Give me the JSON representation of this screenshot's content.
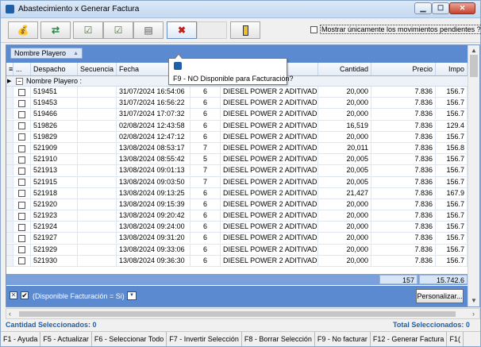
{
  "window": {
    "title": "Abastecimiento x Generar Factura",
    "min_glyph": "▁",
    "max_glyph": "☐",
    "close_glyph": "✕"
  },
  "toolbar": {
    "buttons": [
      {
        "icon": "money-bag-icon",
        "glyph": "💰"
      },
      {
        "icon": "refresh-icon",
        "glyph": "⇄"
      },
      {
        "icon": "check-list-icon",
        "glyph": "☑"
      },
      {
        "icon": "uncheck-list-icon",
        "glyph": "☑"
      },
      {
        "icon": "save-icon",
        "glyph": "▤"
      },
      {
        "icon": "not-available-icon",
        "glyph": "✖"
      },
      {
        "icon": "disabled-icon",
        "glyph": ""
      },
      {
        "icon": "exit-door-icon",
        "glyph": ""
      }
    ],
    "pending_label": "Mostrar únicamente los movimientos pendientes ?"
  },
  "grid": {
    "group_chip": "Nombre Playero",
    "columns": [
      "...",
      "Despacho",
      "Secuencia",
      "Fecha",
      "",
      "",
      "Cantidad",
      "Precio",
      "Impo"
    ],
    "group_row_label": "Nombre Playero :",
    "rows": [
      {
        "despacho": "519451",
        "fecha": "31/07/2024 16:54:06",
        "cod": "6",
        "producto": "DIESEL POWER 2 ADITIVAD",
        "cantidad": "20,000",
        "precio": "7.836",
        "importe": "156.7"
      },
      {
        "despacho": "519453",
        "fecha": "31/07/2024 16:56:22",
        "cod": "6",
        "producto": "DIESEL POWER 2 ADITIVAD",
        "cantidad": "20,000",
        "precio": "7.836",
        "importe": "156.7"
      },
      {
        "despacho": "519466",
        "fecha": "31/07/2024 17:07:32",
        "cod": "6",
        "producto": "DIESEL POWER 2 ADITIVAD",
        "cantidad": "20,000",
        "precio": "7.836",
        "importe": "156.7"
      },
      {
        "despacho": "519826",
        "fecha": "02/08/2024 12:43:58",
        "cod": "6",
        "producto": "DIESEL POWER 2 ADITIVAD",
        "cantidad": "16,519",
        "precio": "7.836",
        "importe": "129.4"
      },
      {
        "despacho": "519829",
        "fecha": "02/08/2024 12:47:12",
        "cod": "6",
        "producto": "DIESEL POWER 2 ADITIVAD",
        "cantidad": "20,000",
        "precio": "7.836",
        "importe": "156.7"
      },
      {
        "despacho": "521909",
        "fecha": "13/08/2024 08:53:17",
        "cod": "7",
        "producto": "DIESEL POWER 2 ADITIVAD",
        "cantidad": "20,011",
        "precio": "7.836",
        "importe": "156.8"
      },
      {
        "despacho": "521910",
        "fecha": "13/08/2024 08:55:42",
        "cod": "5",
        "producto": "DIESEL POWER 2 ADITIVAD",
        "cantidad": "20,005",
        "precio": "7.836",
        "importe": "156.7"
      },
      {
        "despacho": "521913",
        "fecha": "13/08/2024 09:01:13",
        "cod": "7",
        "producto": "DIESEL POWER 2 ADITIVAD",
        "cantidad": "20,005",
        "precio": "7.836",
        "importe": "156.7"
      },
      {
        "despacho": "521915",
        "fecha": "13/08/2024 09:03:50",
        "cod": "7",
        "producto": "DIESEL POWER 2 ADITIVAD",
        "cantidad": "20,005",
        "precio": "7.836",
        "importe": "156.7"
      },
      {
        "despacho": "521918",
        "fecha": "13/08/2024 09:13:25",
        "cod": "6",
        "producto": "DIESEL POWER 2 ADITIVAD",
        "cantidad": "21,427",
        "precio": "7.836",
        "importe": "167.9"
      },
      {
        "despacho": "521920",
        "fecha": "13/08/2024 09:15:39",
        "cod": "6",
        "producto": "DIESEL POWER 2 ADITIVAD",
        "cantidad": "20,000",
        "precio": "7.836",
        "importe": "156.7"
      },
      {
        "despacho": "521923",
        "fecha": "13/08/2024 09:20:42",
        "cod": "6",
        "producto": "DIESEL POWER 2 ADITIVAD",
        "cantidad": "20,000",
        "precio": "7.836",
        "importe": "156.7"
      },
      {
        "despacho": "521924",
        "fecha": "13/08/2024 09:24:00",
        "cod": "6",
        "producto": "DIESEL POWER 2 ADITIVAD",
        "cantidad": "20,000",
        "precio": "7.836",
        "importe": "156.7"
      },
      {
        "despacho": "521927",
        "fecha": "13/08/2024 09:31:20",
        "cod": "6",
        "producto": "DIESEL POWER 2 ADITIVAD",
        "cantidad": "20,000",
        "precio": "7.836",
        "importe": "156.7"
      },
      {
        "despacho": "521929",
        "fecha": "13/08/2024 09:33:06",
        "cod": "6",
        "producto": "DIESEL POWER 2 ADITIVAD",
        "cantidad": "20,000",
        "precio": "7.836",
        "importe": "156.7"
      },
      {
        "despacho": "521930",
        "fecha": "13/08/2024 09:36:30",
        "cod": "6",
        "producto": "DIESEL POWER 2 ADITIVAD",
        "cantidad": "20,000",
        "precio": "7.836",
        "importe": "156.7"
      }
    ],
    "totals": {
      "cantidad": "157",
      "importe": "15.742.6"
    },
    "filter": {
      "clear_glyph": "✕",
      "enabled_glyph": "✔",
      "text": "(Disponible Facturación = Si)",
      "dropdown_glyph": "▼"
    },
    "customize_label": "Personalizar..."
  },
  "tooltip": {
    "text": "F9 - NO Disponible para Facturación?"
  },
  "status": {
    "left": "Cantidad Seleccionados: 0",
    "right": "Total Seleccionados: 0"
  },
  "fkeys": [
    "F1 - Ayuda",
    "F5 - Actualizar",
    "F6 - Seleccionar Todo",
    "F7 - Invertir Selección",
    "F8 - Borrar Selección",
    "F9 - No facturar",
    "F12 - Generar Factura",
    "F1("
  ],
  "colors": {
    "accent": "#5b8ad1",
    "status_text": "#1f5fa8"
  }
}
